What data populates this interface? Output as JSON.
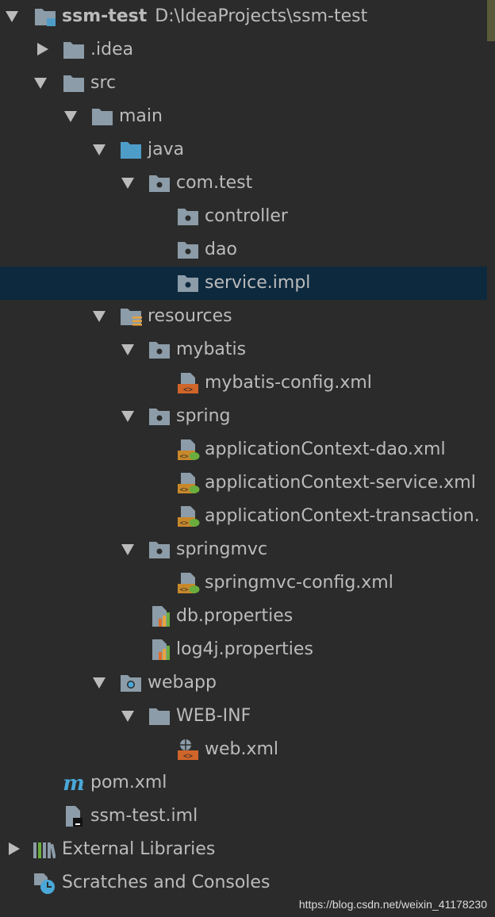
{
  "tree": {
    "root": {
      "name": "ssm-test",
      "path": "D:\\IdeaProjects\\ssm-test"
    },
    "idea": ".idea",
    "src": "src",
    "main": "main",
    "java": "java",
    "com_test": "com.test",
    "controller": "controller",
    "dao": "dao",
    "service_impl": "service.impl",
    "resources": "resources",
    "mybatis": "mybatis",
    "mybatis_config": "mybatis-config.xml",
    "spring": "spring",
    "app_dao": "applicationContext-dao.xml",
    "app_service": "applicationContext-service.xml",
    "app_transaction": "applicationContext-transaction.",
    "springmvc": "springmvc",
    "springmvc_config": "springmvc-config.xml",
    "db_properties": "db.properties",
    "log4j_properties": "log4j.properties",
    "webapp": "webapp",
    "web_inf": "WEB-INF",
    "web_xml": "web.xml",
    "pom": "pom.xml",
    "iml": "ssm-test.iml",
    "external_libraries": "External Libraries",
    "scratches": "Scratches and Consoles"
  },
  "watermark": "https://blog.csdn.net/weixin_41178230",
  "colors": {
    "background": "#2b2b2b",
    "selection": "#0d293e",
    "text": "#bbbbbb",
    "folder": "#8c9ca8",
    "source_folder": "#4e9dc9",
    "xml_orange": "#d0652a",
    "spring_green": "#6aad3d",
    "maven_blue": "#4aa8d8"
  }
}
